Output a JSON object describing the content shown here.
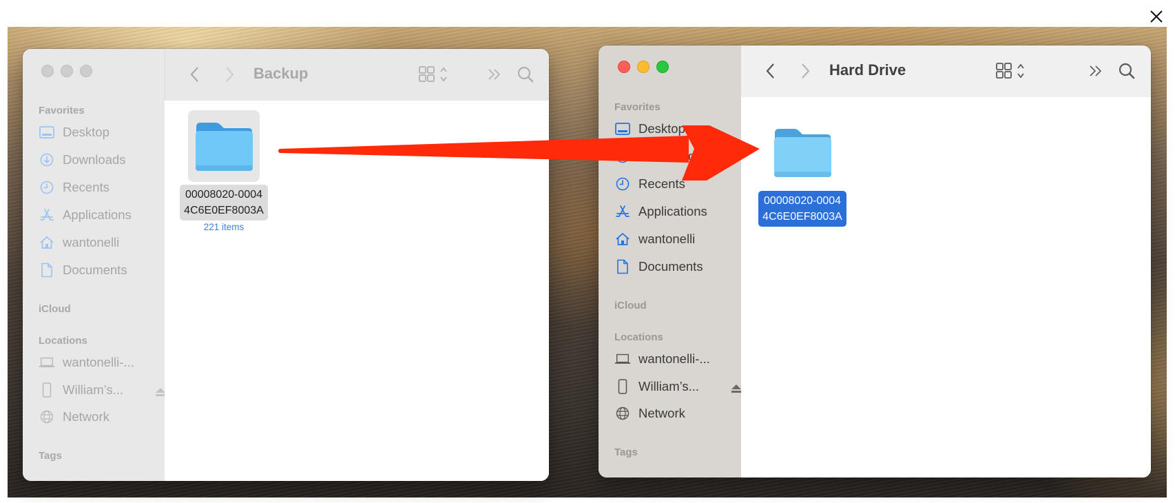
{
  "close_button": {
    "icon": "close-icon"
  },
  "colors": {
    "arrow": "#ff2a0a",
    "selection": "#2b6fd9",
    "folder": "#6cc8f8",
    "item_count": "#3b82e0"
  },
  "left_window": {
    "title": "Backup",
    "active": false,
    "sidebar": {
      "favorites_label": "Favorites",
      "favorites": [
        {
          "label": "Desktop",
          "icon": "desktop-icon"
        },
        {
          "label": "Downloads",
          "icon": "downloads-icon"
        },
        {
          "label": "Recents",
          "icon": "clock-icon"
        },
        {
          "label": "Applications",
          "icon": "applications-icon"
        },
        {
          "label": "wantonelli",
          "icon": "home-icon"
        },
        {
          "label": "Documents",
          "icon": "document-icon"
        }
      ],
      "icloud_label": "iCloud",
      "locations_label": "Locations",
      "locations": [
        {
          "label": "wantonelli-...",
          "icon": "laptop-icon"
        },
        {
          "label": "William’s...",
          "icon": "phone-icon",
          "eject": true
        },
        {
          "label": "Network",
          "icon": "globe-icon"
        }
      ],
      "tags_label": "Tags"
    },
    "files": [
      {
        "name_line1": "00008020-0004",
        "name_line2": "4C6E0EF8003A",
        "subtitle": "221 items",
        "state": "highlighted"
      }
    ]
  },
  "right_window": {
    "title": "Hard Drive",
    "active": true,
    "sidebar": {
      "favorites_label": "Favorites",
      "favorites": [
        {
          "label": "Desktop",
          "icon": "desktop-icon"
        },
        {
          "label": "Downloads",
          "icon": "downloads-icon"
        },
        {
          "label": "Recents",
          "icon": "clock-icon"
        },
        {
          "label": "Applications",
          "icon": "applications-icon"
        },
        {
          "label": "wantonelli",
          "icon": "home-icon"
        },
        {
          "label": "Documents",
          "icon": "document-icon"
        }
      ],
      "icloud_label": "iCloud",
      "locations_label": "Locations",
      "locations": [
        {
          "label": "wantonelli-...",
          "icon": "laptop-icon"
        },
        {
          "label": "William’s...",
          "icon": "phone-icon",
          "eject": true
        },
        {
          "label": "Network",
          "icon": "globe-icon"
        }
      ],
      "tags_label": "Tags"
    },
    "files": [
      {
        "name_line1": "00008020-0004",
        "name_line2": "4C6E0EF8003A",
        "state": "selected"
      }
    ]
  },
  "annotation": {
    "type": "arrow",
    "from": "left-window-folder",
    "to": "right-window-folder"
  }
}
